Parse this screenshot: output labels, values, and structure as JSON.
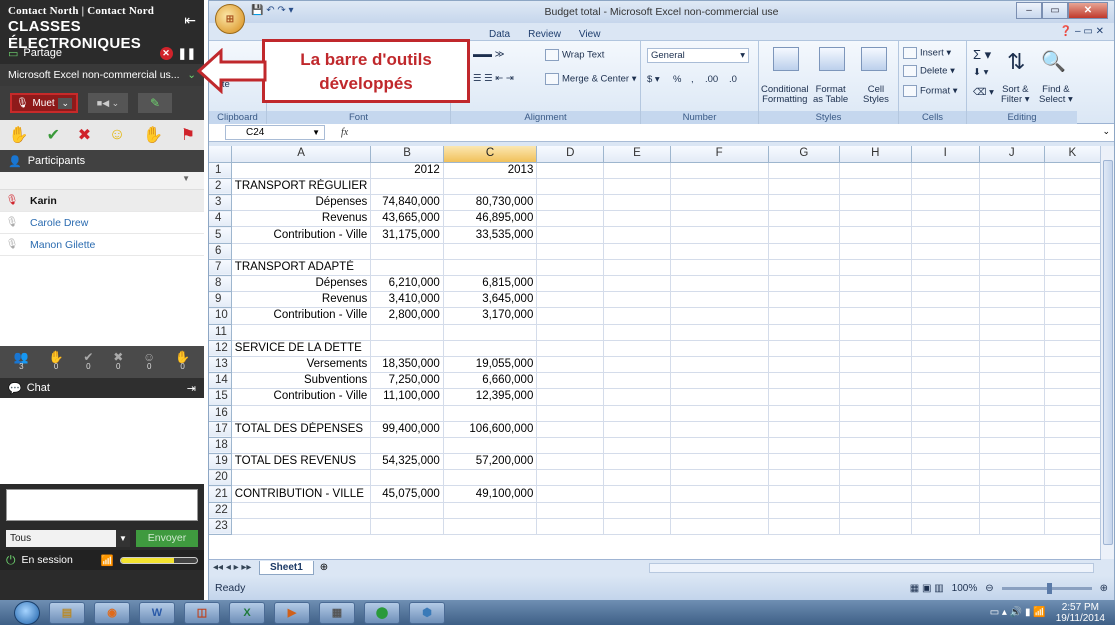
{
  "left_panel": {
    "logo_line1": "Contact North | Contact Nord",
    "logo_line2": "CLASSES ÉLECTRONIQUES",
    "share_label": "Partage",
    "shared_app": "Microsoft Excel non-commercial us...",
    "mute_label": "Muet",
    "participants_label": "Participants",
    "participants": [
      {
        "name": "Karin",
        "self": true
      },
      {
        "name": "Carole Drew",
        "self": false
      },
      {
        "name": "Manon Gilette",
        "self": false
      }
    ],
    "counts": [
      "3",
      "0",
      "0",
      "0",
      "0",
      "0"
    ],
    "chat_label": "Chat",
    "recipient": "Tous",
    "send_label": "Envoyer",
    "session_status": "En session",
    "signal_level": 0.7
  },
  "excel": {
    "window_title": "Budget total - Microsoft Excel non-commercial use",
    "tabs": [
      "Data",
      "Review",
      "View"
    ],
    "ribbon": {
      "wrap_text": "Wrap Text",
      "merge_center": "Merge & Center",
      "number_format": "General",
      "currency": "$",
      "percent": "%",
      "comma": ",",
      "inc_decimal": ".00",
      "dec_decimal": ".0",
      "conditional": "Conditional",
      "conditional2": "Formatting",
      "format_as": "Format",
      "format_as2": "as Table",
      "cell": "Cell",
      "cell2": "Styles",
      "insert": "Insert",
      "delete": "Delete",
      "format": "Format",
      "sum": "Σ",
      "sort": "Sort &",
      "sort2": "Filter",
      "find": "Find &",
      "find2": "Select",
      "paste_partial": "iste",
      "groups": {
        "clipboard": "Clipboard",
        "font": "Font",
        "alignment": "Alignment",
        "number": "Number",
        "styles": "Styles",
        "cells": "Cells",
        "editing": "Editing"
      }
    },
    "name_box": "C24",
    "fx": "fx",
    "columns": [
      "A",
      "B",
      "C",
      "D",
      "E",
      "F",
      "G",
      "H",
      "I",
      "J",
      "K"
    ],
    "rows": [
      {
        "n": "1",
        "a": "",
        "b": "2012",
        "c": "2013"
      },
      {
        "n": "2",
        "a": "TRANSPORT RÉGULIER",
        "b": "",
        "c": ""
      },
      {
        "n": "3",
        "a": "Dépenses",
        "b": "74,840,000",
        "c": "80,730,000",
        "right": true
      },
      {
        "n": "4",
        "a": "Revenus",
        "b": "43,665,000",
        "c": "46,895,000",
        "right": true
      },
      {
        "n": "5",
        "a": "Contribution - Ville",
        "b": "31,175,000",
        "c": "33,535,000",
        "right": true
      },
      {
        "n": "6",
        "a": "",
        "b": "",
        "c": ""
      },
      {
        "n": "7",
        "a": "TRANSPORT ADAPTÉ",
        "b": "",
        "c": ""
      },
      {
        "n": "8",
        "a": "Dépenses",
        "b": "6,210,000",
        "c": "6,815,000",
        "right": true
      },
      {
        "n": "9",
        "a": "Revenus",
        "b": "3,410,000",
        "c": "3,645,000",
        "right": true
      },
      {
        "n": "10",
        "a": "Contribution - Ville",
        "b": "2,800,000",
        "c": "3,170,000",
        "right": true
      },
      {
        "n": "11",
        "a": "",
        "b": "",
        "c": ""
      },
      {
        "n": "12",
        "a": "SERVICE DE LA DETTE",
        "b": "",
        "c": ""
      },
      {
        "n": "13",
        "a": "Versements",
        "b": "18,350,000",
        "c": "19,055,000",
        "right": true
      },
      {
        "n": "14",
        "a": "Subventions",
        "b": "7,250,000",
        "c": "6,660,000",
        "right": true
      },
      {
        "n": "15",
        "a": "Contribution - Ville",
        "b": "11,100,000",
        "c": "12,395,000",
        "right": true
      },
      {
        "n": "16",
        "a": "",
        "b": "",
        "c": ""
      },
      {
        "n": "17",
        "a": "TOTAL DES DÉPENSES",
        "b": "99,400,000",
        "c": "106,600,000"
      },
      {
        "n": "18",
        "a": "",
        "b": "",
        "c": ""
      },
      {
        "n": "19",
        "a": "TOTAL DES REVENUS",
        "b": "54,325,000",
        "c": "57,200,000"
      },
      {
        "n": "20",
        "a": "",
        "b": "",
        "c": ""
      },
      {
        "n": "21",
        "a": "CONTRIBUTION - VILLE",
        "b": "45,075,000",
        "c": "49,100,000"
      },
      {
        "n": "22",
        "a": "",
        "b": "",
        "c": ""
      },
      {
        "n": "23",
        "a": "",
        "b": "",
        "c": ""
      }
    ],
    "sheet_tab": "Sheet1",
    "status": "Ready",
    "zoom": "100%"
  },
  "callout": {
    "line1": "La barre d'outils",
    "line2": "développés",
    "color": "#c0282c"
  },
  "taskbar": {
    "time": "2:57 PM",
    "date": "19/11/2014"
  }
}
